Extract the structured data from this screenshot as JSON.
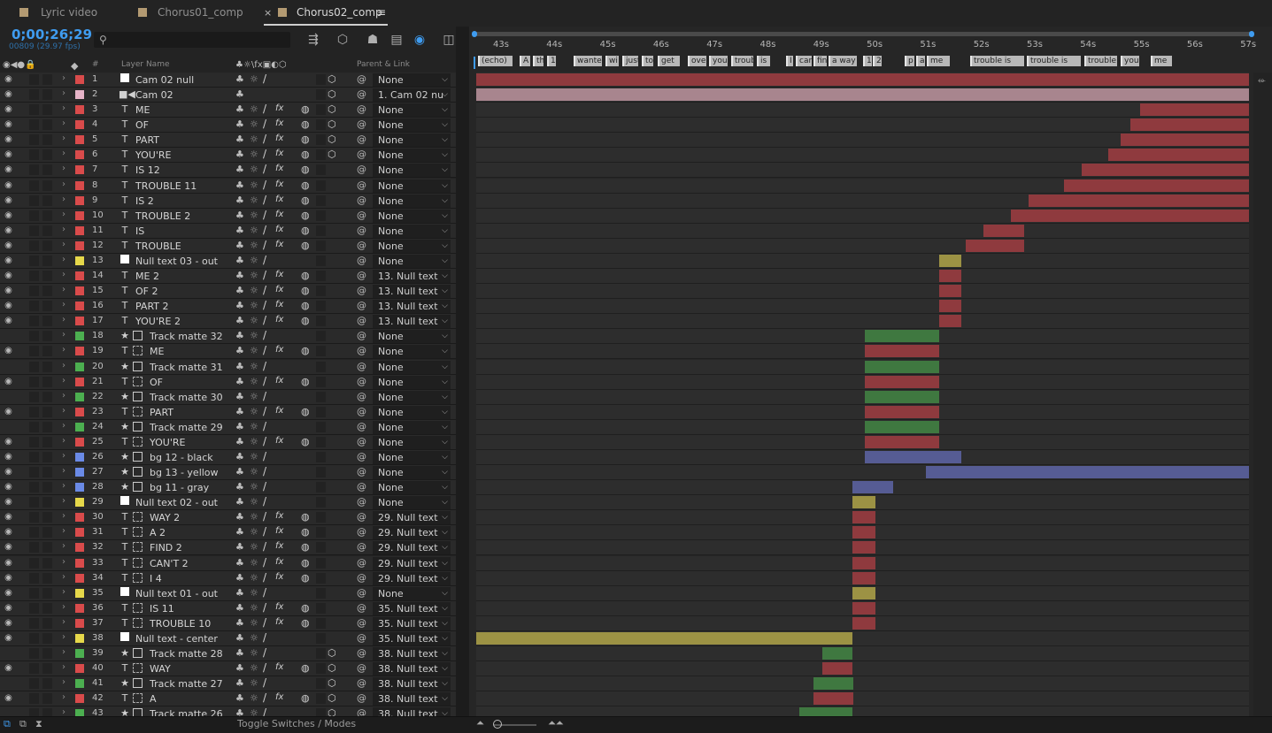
{
  "tabs": [
    {
      "label": "Lyric video",
      "active": false
    },
    {
      "label": "Chorus01_comp",
      "active": false
    },
    {
      "label": "Chorus02_comp",
      "active": true
    }
  ],
  "timecode": "0;00;26;29",
  "fps": "00809 (29.97 fps)",
  "columns": {
    "layer_name": "Layer Name",
    "parent": "Parent & Link",
    "num": "#"
  },
  "ruler_ticks": [
    "43s",
    "44s",
    "45s",
    "46s",
    "47s",
    "48s",
    "49s",
    "50s",
    "51s",
    "52s",
    "53s",
    "54s",
    "55s",
    "56s",
    "57s"
  ],
  "markers": [
    {
      "label": "(echo)",
      "start": 0.004,
      "w": 0.044
    },
    {
      "label": "A",
      "start": 0.058,
      "w": 0.014
    },
    {
      "label": "th",
      "start": 0.075,
      "w": 0.014
    },
    {
      "label": "1",
      "start": 0.093,
      "w": 0.011
    },
    {
      "label": "wante",
      "start": 0.128,
      "w": 0.036
    },
    {
      "label": "wi",
      "start": 0.168,
      "w": 0.017
    },
    {
      "label": "just",
      "start": 0.19,
      "w": 0.021
    },
    {
      "label": "to",
      "start": 0.215,
      "w": 0.015
    },
    {
      "label": "get",
      "start": 0.236,
      "w": 0.028
    },
    {
      "label": "ove",
      "start": 0.274,
      "w": 0.024
    },
    {
      "label": "you",
      "start": 0.302,
      "w": 0.024
    },
    {
      "label": "troub",
      "start": 0.33,
      "w": 0.029
    },
    {
      "label": "is",
      "start": 0.363,
      "w": 0.017
    },
    {
      "label": "I",
      "start": 0.401,
      "w": 0.009
    },
    {
      "label": "can",
      "start": 0.413,
      "w": 0.02
    },
    {
      "label": "fin",
      "start": 0.436,
      "w": 0.017
    },
    {
      "label": "a way",
      "start": 0.456,
      "w": 0.036
    },
    {
      "label": "1",
      "start": 0.5,
      "w": 0.011
    },
    {
      "label": "2",
      "start": 0.513,
      "w": 0.011
    },
    {
      "label": "p",
      "start": 0.553,
      "w": 0.013
    },
    {
      "label": "a",
      "start": 0.568,
      "w": 0.011
    },
    {
      "label": "me",
      "start": 0.582,
      "w": 0.03
    },
    {
      "label": "trouble is",
      "start": 0.638,
      "w": 0.07
    },
    {
      "label": "trouble is",
      "start": 0.711,
      "w": 0.07
    },
    {
      "label": "trouble",
      "start": 0.785,
      "w": 0.042
    },
    {
      "label": "you",
      "start": 0.831,
      "w": 0.024
    },
    {
      "label": "me",
      "start": 0.87,
      "w": 0.027
    }
  ],
  "colors": {
    "red": "#8f3a3e",
    "pink": "#a8858e",
    "yellow": "#9c9244",
    "green": "#3f7840",
    "blue": "#565c94",
    "lab_red": "#d94b4b",
    "lab_pink": "#e6b4c8",
    "lab_yellow": "#e6d84a",
    "lab_green": "#4caf50",
    "lab_blue": "#6a8ae6"
  },
  "layers": [
    {
      "n": "1",
      "name": "Cam 02 null",
      "type": "square",
      "label": "lab_red",
      "eye": true,
      "parent": "None",
      "bar": "red",
      "bs": 0,
      "be": 1
    },
    {
      "n": "2",
      "name": "Cam 02",
      "type": "camera",
      "label": "lab_pink",
      "eye": true,
      "parent": "1. Cam 02 nu",
      "bar": "pink",
      "bs": 0,
      "be": 1
    },
    {
      "n": "3",
      "name": "ME",
      "type": "text",
      "label": "lab_red",
      "eye": true,
      "parent": "None",
      "bar": "red",
      "bs": 0.859,
      "be": 1
    },
    {
      "n": "4",
      "name": "OF",
      "type": "text",
      "label": "lab_red",
      "eye": true,
      "parent": "None",
      "bar": "red",
      "bs": 0.847,
      "be": 1
    },
    {
      "n": "5",
      "name": "PART",
      "type": "text",
      "label": "lab_red",
      "eye": true,
      "parent": "None",
      "bar": "red",
      "bs": 0.834,
      "be": 1
    },
    {
      "n": "6",
      "name": "YOU'RE",
      "type": "text",
      "label": "lab_red",
      "eye": true,
      "parent": "None",
      "bar": "red",
      "bs": 0.818,
      "be": 1
    },
    {
      "n": "7",
      "name": "IS 12",
      "type": "text",
      "label": "lab_red",
      "eye": true,
      "parent": "None",
      "bar": "red",
      "bs": 0.784,
      "be": 1
    },
    {
      "n": "8",
      "name": "TROUBLE 11",
      "type": "text",
      "label": "lab_red",
      "eye": true,
      "parent": "None",
      "bar": "red",
      "bs": 0.761,
      "be": 1
    },
    {
      "n": "9",
      "name": "IS 2",
      "type": "text",
      "label": "lab_red",
      "eye": true,
      "parent": "None",
      "bar": "red",
      "bs": 0.715,
      "be": 1
    },
    {
      "n": "10",
      "name": "TROUBLE 2",
      "type": "text",
      "label": "lab_red",
      "eye": true,
      "parent": "None",
      "bar": "red",
      "bs": 0.692,
      "be": 1
    },
    {
      "n": "11",
      "name": "IS",
      "type": "text",
      "label": "lab_red",
      "eye": true,
      "parent": "None",
      "bar": "red",
      "bs": 0.656,
      "be": 0.709
    },
    {
      "n": "12",
      "name": "TROUBLE",
      "type": "text",
      "label": "lab_red",
      "eye": true,
      "parent": "None",
      "bar": "red",
      "bs": 0.633,
      "be": 0.709
    },
    {
      "n": "13",
      "name": "Null text 03 - out",
      "type": "square",
      "label": "lab_yellow",
      "eye": true,
      "parent": "None",
      "bar": "yellow",
      "bs": 0.599,
      "be": 0.628
    },
    {
      "n": "14",
      "name": "ME 2",
      "type": "text",
      "label": "lab_red",
      "eye": true,
      "parent": "13. Null text",
      "bar": "red",
      "bs": 0.599,
      "be": 0.628
    },
    {
      "n": "15",
      "name": "OF 2",
      "type": "text",
      "label": "lab_red",
      "eye": true,
      "parent": "13. Null text",
      "bar": "red",
      "bs": 0.599,
      "be": 0.628
    },
    {
      "n": "16",
      "name": "PART 2",
      "type": "text",
      "label": "lab_red",
      "eye": true,
      "parent": "13. Null text",
      "bar": "red",
      "bs": 0.599,
      "be": 0.628
    },
    {
      "n": "17",
      "name": "YOU'RE 2",
      "type": "text",
      "label": "lab_red",
      "eye": true,
      "parent": "13. Null text",
      "bar": "red",
      "bs": 0.599,
      "be": 0.628
    },
    {
      "n": "18",
      "name": "Track matte 32",
      "type": "shape",
      "label": "lab_green",
      "eye": false,
      "parent": "None",
      "bar": "green",
      "bs": 0.503,
      "be": 0.599
    },
    {
      "n": "19",
      "name": "ME",
      "type": "text",
      "label": "lab_red",
      "eye": true,
      "parent": "None",
      "bar": "red",
      "bs": 0.503,
      "be": 0.599
    },
    {
      "n": "20",
      "name": "Track matte 31",
      "type": "shape",
      "label": "lab_green",
      "eye": false,
      "parent": "None",
      "bar": "green",
      "bs": 0.503,
      "be": 0.599
    },
    {
      "n": "21",
      "name": "OF",
      "type": "text",
      "label": "lab_red",
      "eye": true,
      "parent": "None",
      "bar": "red",
      "bs": 0.503,
      "be": 0.599
    },
    {
      "n": "22",
      "name": "Track matte 30",
      "type": "shape",
      "label": "lab_green",
      "eye": false,
      "parent": "None",
      "bar": "green",
      "bs": 0.503,
      "be": 0.599
    },
    {
      "n": "23",
      "name": "PART",
      "type": "text",
      "label": "lab_red",
      "eye": true,
      "parent": "None",
      "bar": "red",
      "bs": 0.503,
      "be": 0.599
    },
    {
      "n": "24",
      "name": "Track matte 29",
      "type": "shape",
      "label": "lab_green",
      "eye": false,
      "parent": "None",
      "bar": "green",
      "bs": 0.503,
      "be": 0.599
    },
    {
      "n": "25",
      "name": "YOU'RE",
      "type": "text",
      "label": "lab_red",
      "eye": true,
      "parent": "None",
      "bar": "red",
      "bs": 0.503,
      "be": 0.599
    },
    {
      "n": "26",
      "name": "bg 12 - black",
      "type": "shape",
      "label": "lab_blue",
      "eye": true,
      "parent": "None",
      "bar": "blue",
      "bs": 0.503,
      "be": 0.628
    },
    {
      "n": "27",
      "name": "bg 13 - yellow",
      "type": "shape",
      "label": "lab_blue",
      "eye": true,
      "parent": "None",
      "bar": "blue",
      "bs": 0.582,
      "be": 1
    },
    {
      "n": "28",
      "name": "bg 11 - gray",
      "type": "shape",
      "label": "lab_blue",
      "eye": true,
      "parent": "None",
      "bar": "blue",
      "bs": 0.487,
      "be": 0.54
    },
    {
      "n": "29",
      "name": "Null text 02 - out",
      "type": "square",
      "label": "lab_yellow",
      "eye": true,
      "parent": "None",
      "bar": "yellow",
      "bs": 0.487,
      "be": 0.517
    },
    {
      "n": "30",
      "name": "WAY 2",
      "type": "text",
      "label": "lab_red",
      "eye": true,
      "parent": "29. Null text",
      "bar": "red",
      "bs": 0.487,
      "be": 0.517
    },
    {
      "n": "31",
      "name": "A 2",
      "type": "text",
      "label": "lab_red",
      "eye": true,
      "parent": "29. Null text",
      "bar": "red",
      "bs": 0.487,
      "be": 0.517
    },
    {
      "n": "32",
      "name": "FIND 2",
      "type": "text",
      "label": "lab_red",
      "eye": true,
      "parent": "29. Null text",
      "bar": "red",
      "bs": 0.487,
      "be": 0.517
    },
    {
      "n": "33",
      "name": "CAN'T 2",
      "type": "text",
      "label": "lab_red",
      "eye": true,
      "parent": "29. Null text",
      "bar": "red",
      "bs": 0.487,
      "be": 0.517
    },
    {
      "n": "34",
      "name": "I 4",
      "type": "text",
      "label": "lab_red",
      "eye": true,
      "parent": "29. Null text",
      "bar": "red",
      "bs": 0.487,
      "be": 0.517
    },
    {
      "n": "35",
      "name": "Null text 01 - out",
      "type": "square",
      "label": "lab_yellow",
      "eye": true,
      "parent": "None",
      "bar": "yellow",
      "bs": 0.487,
      "be": 0.517
    },
    {
      "n": "36",
      "name": "IS 11",
      "type": "text",
      "label": "lab_red",
      "eye": true,
      "parent": "35. Null text",
      "bar": "red",
      "bs": 0.487,
      "be": 0.517
    },
    {
      "n": "37",
      "name": "TROUBLE 10",
      "type": "text",
      "label": "lab_red",
      "eye": true,
      "parent": "35. Null text",
      "bar": "red",
      "bs": 0.487,
      "be": 0.517
    },
    {
      "n": "38",
      "name": "Null text - center",
      "type": "square",
      "label": "lab_yellow",
      "eye": true,
      "parent": "35. Null text",
      "bar": "yellow",
      "bs": 0,
      "be": 0.487
    },
    {
      "n": "39",
      "name": "Track matte 28",
      "type": "shape",
      "label": "lab_green",
      "eye": false,
      "parent": "38. Null text",
      "bar": "green",
      "bs": 0.448,
      "be": 0.487
    },
    {
      "n": "40",
      "name": "WAY",
      "type": "text",
      "label": "lab_red",
      "eye": true,
      "parent": "38. Null text",
      "bar": "red",
      "bs": 0.448,
      "be": 0.487
    },
    {
      "n": "41",
      "name": "Track matte 27",
      "type": "shape",
      "label": "lab_green",
      "eye": false,
      "parent": "38. Null text",
      "bar": "green",
      "bs": 0.436,
      "be": 0.487
    },
    {
      "n": "42",
      "name": "A",
      "type": "text",
      "label": "lab_red",
      "eye": true,
      "parent": "38. Null text",
      "bar": "red",
      "bs": 0.436,
      "be": 0.487
    },
    {
      "n": "43",
      "name": "Track matte 26",
      "type": "shape",
      "label": "lab_green",
      "eye": false,
      "parent": "38. Null text",
      "bar": "green",
      "bs": 0.418,
      "be": 0.487
    }
  ],
  "bottom": {
    "toggle_label": "Toggle Switches / Modes"
  }
}
